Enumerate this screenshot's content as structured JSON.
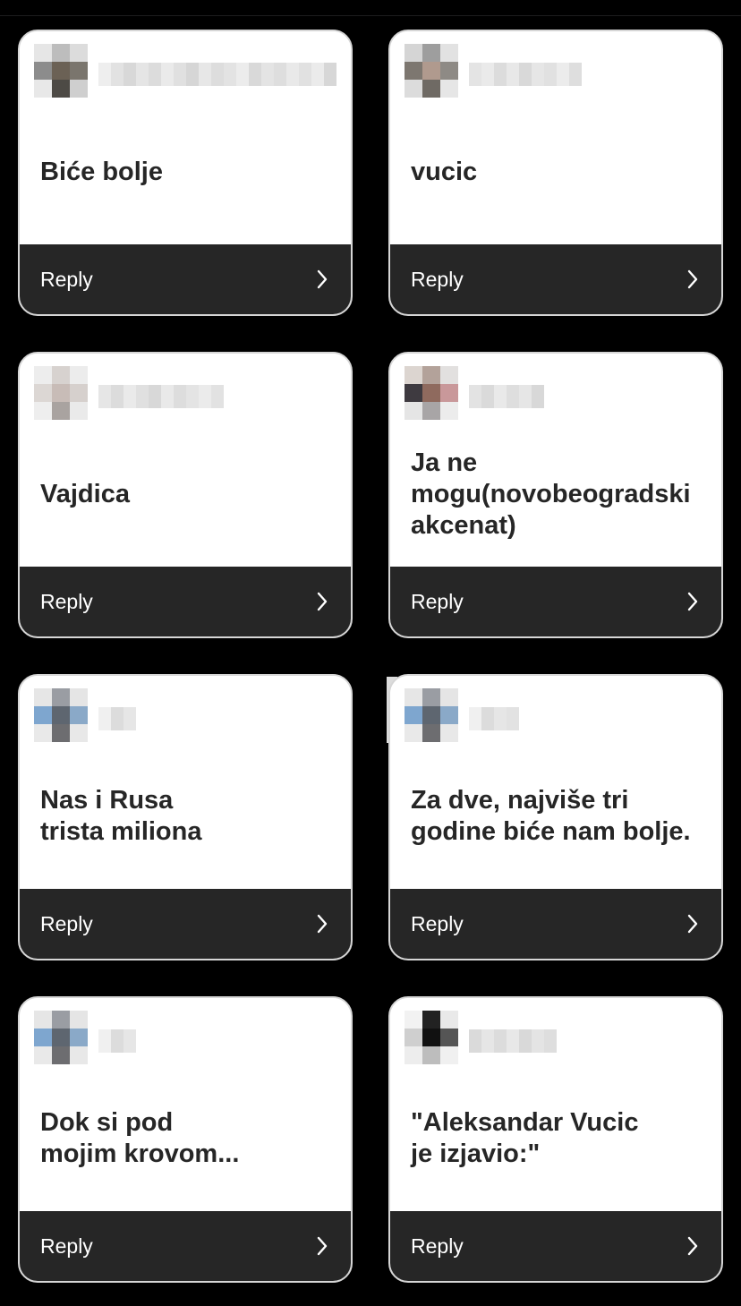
{
  "screen": {
    "background": "#000000",
    "card_top_color": "#ffffff",
    "card_bottom_color": "#262626",
    "prompt_text_color": "#262626",
    "reply_text_color": "#ffffff",
    "card_border_color": "#d6d6d6"
  },
  "cards": [
    {
      "prompt": "Biće bolje",
      "reply_label": "Reply",
      "chevron_icon": "chevron-right-icon",
      "avatar_pixels": [
        "#e6e6e6",
        "#bdbdbd",
        "#dcdcdc",
        "#8c8c8c",
        "#6b6155",
        "#7a756d",
        "#e8e8e8",
        "#4d4a45",
        "#cfcfcf"
      ],
      "username_pixels": [
        "#eeeeee",
        "#e2e2e2",
        "#d8d8d8",
        "#e5e5e5",
        "#dcdcdc",
        "#eaeaea",
        "#e0e0e0",
        "#d6d6d6",
        "#e7e7e7",
        "#dddddd",
        "#e3e3e3",
        "#ececec",
        "#d9d9d9",
        "#e4e4e4",
        "#dedede",
        "#e9e9e9",
        "#e1e1e1",
        "#ebebeb",
        "#d7d7d7"
      ]
    },
    {
      "prompt": "vucic",
      "reply_label": "Reply",
      "chevron_icon": "chevron-right-icon",
      "avatar_pixels": [
        "#d5d5d5",
        "#9e9e9e",
        "#e2e2e2",
        "#7d7770",
        "#b09a8e",
        "#8e8a85",
        "#dcdcdc",
        "#6f6a64",
        "#e6e6e6"
      ],
      "username_pixels": [
        "#e4e4e4",
        "#eaeaea",
        "#dcdcdc",
        "#e8e8e8",
        "#d9d9d9",
        "#e6e6e6",
        "#e1e1e1",
        "#ececec",
        "#dedede"
      ]
    },
    {
      "prompt": "Vajdica",
      "reply_label": "Reply",
      "chevron_icon": "chevron-right-icon",
      "avatar_pixels": [
        "#ededed",
        "#d7d2cf",
        "#ececec",
        "#dcd7d4",
        "#c8bcb7",
        "#d6d0cd",
        "#eeeeee",
        "#a9a3a0",
        "#eaeaea"
      ],
      "username_pixels": [
        "#e6e6e6",
        "#dcdcdc",
        "#eaeaea",
        "#e0e0e0",
        "#d8d8d8",
        "#e9e9e9",
        "#dddddd",
        "#e4e4e4",
        "#ebebeb",
        "#e2e2e2"
      ]
    },
    {
      "prompt": "Ja ne\nmogu(novobeogradski\nakcenat)",
      "reply_label": "Reply",
      "chevron_icon": "chevron-right-icon",
      "avatar_pixels": [
        "#dcd5d0",
        "#b3a29a",
        "#e2e0df",
        "#3e3a40",
        "#8f6a5e",
        "#c9989a",
        "#e5e5e5",
        "#a8a5a6",
        "#ececec"
      ],
      "username_pixels": [
        "#e3e3e3",
        "#dadada",
        "#e9e9e9",
        "#dedede",
        "#e6e6e6",
        "#d8d8d8"
      ]
    },
    {
      "prompt": "Nas i Rusa\ntrista miliona",
      "reply_label": "Reply",
      "chevron_icon": "chevron-right-icon",
      "avatar_pixels": [
        "#e6e6e6",
        "#9a9da3",
        "#e5e5e5",
        "#7ea6cf",
        "#5e6670",
        "#8aa9c8",
        "#e9e9e9",
        "#6d6d70",
        "#e8e8e8"
      ],
      "username_pixels": [
        "#f0f0f0",
        "#dcdcdc",
        "#e6e6e6"
      ]
    },
    {
      "prompt": "Za dve, najviše tri\ngodine biće nam bolje.",
      "reply_label": "Reply",
      "chevron_icon": "chevron-right-icon",
      "avatar_pixels": [
        "#e6e6e6",
        "#9a9da3",
        "#e5e5e5",
        "#7ea6cf",
        "#5e6670",
        "#8aa9c8",
        "#e9e9e9",
        "#6d6d70",
        "#e8e8e8"
      ],
      "username_pixels": [
        "#f0f0f0",
        "#dcdcdc",
        "#e6e6e6",
        "#e2e2e2"
      ]
    },
    {
      "prompt": "Dok si pod\nmojim krovom...",
      "reply_label": "Reply",
      "chevron_icon": "chevron-right-icon",
      "avatar_pixels": [
        "#e6e6e6",
        "#9a9da3",
        "#e5e5e5",
        "#7ea6cf",
        "#5e6670",
        "#8aa9c8",
        "#e9e9e9",
        "#6d6d70",
        "#e8e8e8"
      ],
      "username_pixels": [
        "#f0f0f0",
        "#dcdcdc",
        "#e6e6e6"
      ]
    },
    {
      "prompt": "\"Aleksandar Vucic\nje izjavio:\"",
      "reply_label": "Reply",
      "chevron_icon": "chevron-right-icon",
      "avatar_pixels": [
        "#f2f2f2",
        "#222222",
        "#e9e9e9",
        "#cfcfcf",
        "#111111",
        "#555555",
        "#ededed",
        "#bdbdbd",
        "#f0f0f0"
      ],
      "username_pixels": [
        "#dadada",
        "#e6e6e6",
        "#dcdcdc",
        "#e8e8e8",
        "#d9d9d9",
        "#e4e4e4",
        "#dedede"
      ]
    }
  ]
}
